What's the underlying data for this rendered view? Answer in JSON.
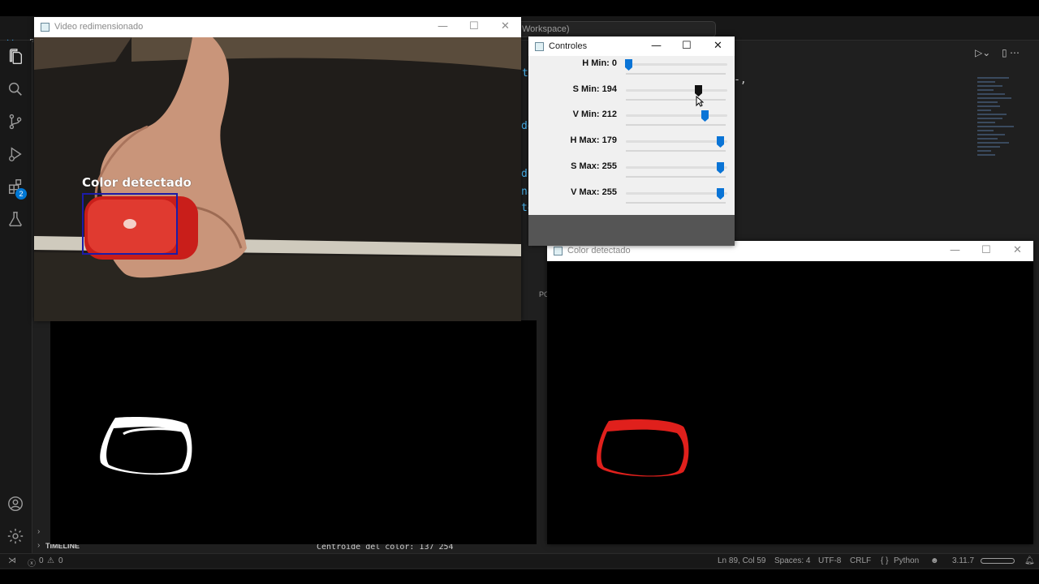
{
  "vscode": {
    "title_fragment": "Workspace)",
    "activity_badge": "2",
    "code_fragments": [
      "ta",
      "de",
      "di",
      "na",
      "te"
    ],
    "status": {
      "errors": "0",
      "warnings": "0",
      "position": "Ln 89, Col 59",
      "spaces": "Spaces: 4",
      "encoding": "UTF-8",
      "eol": "CRLF",
      "language_braces": "{ }",
      "language": "Python",
      "version": "3.11.7"
    },
    "timeline_label": "TIMELINE",
    "panel_fragment": "PC",
    "terminal_output": "Centroide del color:  137 254",
    "activity_icons": [
      "explorer-icon",
      "search-icon",
      "source-control-icon",
      "run-debug-icon",
      "extensions-icon",
      "testing-icon",
      "account-icon",
      "settings-gear-icon"
    ]
  },
  "windows": {
    "video": {
      "title": "Video redimensionado",
      "overlay_label": "Color detectado",
      "box_color": "#1c1ca8"
    },
    "controls": {
      "title": "Controles",
      "sliders": [
        {
          "label": "H Min: 0",
          "value": 0,
          "max": 179
        },
        {
          "label": "S Min: 194",
          "value": 194,
          "max": 255
        },
        {
          "label": "V Min: 212",
          "value": 212,
          "max": 255
        },
        {
          "label": "H Max: 179",
          "value": 179,
          "max": 179
        },
        {
          "label": "S Max: 255",
          "value": 255,
          "max": 255
        },
        {
          "label": "V Max: 255",
          "value": 255,
          "max": 255
        }
      ],
      "active_slider": 1,
      "accent": "#0a74d6"
    },
    "detected": {
      "title": "Color detectado",
      "mask_color": "#e0201c"
    }
  },
  "window_controls": {
    "minimize": "—",
    "maximize": "☐",
    "close": "✕"
  }
}
